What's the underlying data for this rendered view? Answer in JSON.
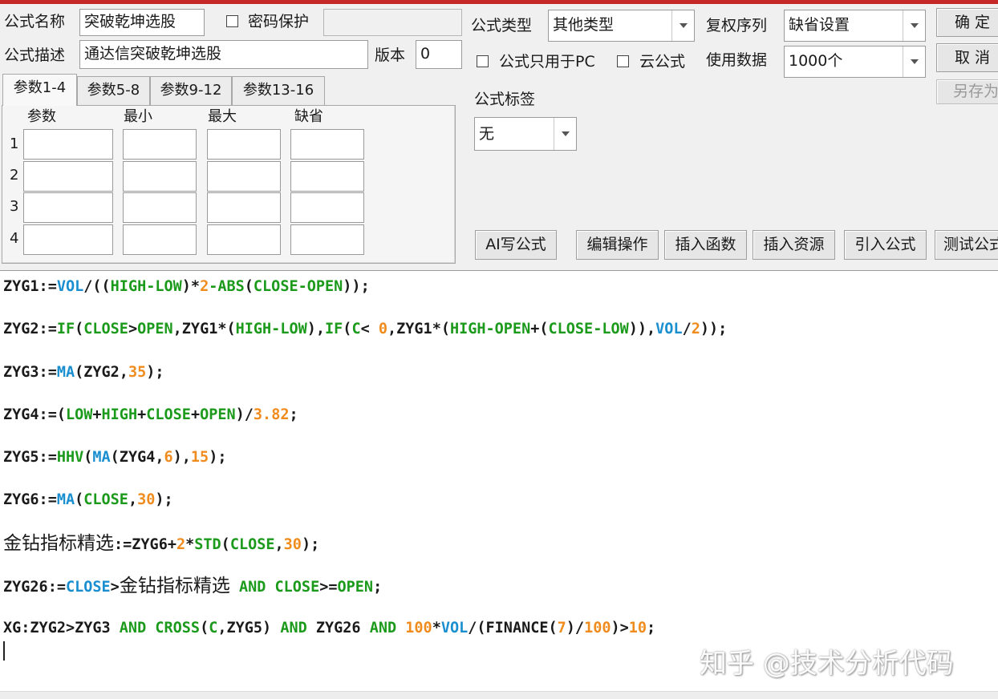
{
  "form": {
    "name_label": "公式名称",
    "name_value": "突破乾坤选股",
    "password_label": "密码保护",
    "desc_label": "公式描述",
    "desc_value": "通达信突破乾坤选股",
    "version_label": "版本",
    "version_value": "0",
    "type_label": "公式类型",
    "type_value": "其他类型",
    "fuquan_label": "复权序列",
    "fuquan_value": "缺省设置",
    "pc_only_label": "公式只用于PC",
    "cloud_label": "云公式",
    "data_label": "使用数据",
    "data_value": "1000个",
    "tag_label": "公式标签",
    "tag_value": "无"
  },
  "buttons": {
    "ok": "确 定",
    "cancel": "取 消",
    "save_as": "另存为",
    "ai_write": "AI写公式",
    "edit_ops": "编辑操作",
    "insert_func": "插入函数",
    "insert_res": "插入资源",
    "import_formula": "引入公式",
    "test_formula": "测试公式"
  },
  "params": {
    "tabs": [
      "参数1-4",
      "参数5-8",
      "参数9-12",
      "参数13-16"
    ],
    "headers": [
      "参数",
      "最小",
      "最大",
      "缺省"
    ],
    "rows": [
      "1",
      "2",
      "3",
      "4"
    ]
  },
  "code_lines": [
    [
      [
        "t",
        "ZYG1:="
      ],
      [
        "f",
        "VOL"
      ],
      [
        "t",
        "/(("
      ],
      [
        "k",
        "HIGH-LOW"
      ],
      [
        "t",
        ")*"
      ],
      [
        "n",
        "2"
      ],
      [
        "k",
        "-ABS"
      ],
      [
        "t",
        "("
      ],
      [
        "k",
        "CLOSE-OPEN"
      ],
      [
        "t",
        "));"
      ]
    ],
    [
      [
        "t",
        "ZYG2:="
      ],
      [
        "k",
        "IF"
      ],
      [
        "t",
        "("
      ],
      [
        "k",
        "CLOSE"
      ],
      [
        "t",
        ">"
      ],
      [
        "k",
        "OPEN"
      ],
      [
        "t",
        ",ZYG1*("
      ],
      [
        "k",
        "HIGH-LOW"
      ],
      [
        "t",
        "),"
      ],
      [
        "k",
        "IF"
      ],
      [
        "t",
        "("
      ],
      [
        "k",
        "C"
      ],
      [
        "t",
        "< "
      ],
      [
        "n",
        "0"
      ],
      [
        "t",
        ",ZYG1*("
      ],
      [
        "k",
        "HIGH-OPEN"
      ],
      [
        "t",
        "+("
      ],
      [
        "k",
        "CLOSE-LOW"
      ],
      [
        "t",
        ")),"
      ],
      [
        "f",
        "VOL"
      ],
      [
        "t",
        "/"
      ],
      [
        "n",
        "2"
      ],
      [
        "t",
        "));"
      ]
    ],
    [
      [
        "t",
        "ZYG3:="
      ],
      [
        "f",
        "MA"
      ],
      [
        "t",
        "(ZYG2,"
      ],
      [
        "n",
        "35"
      ],
      [
        "t",
        ");"
      ]
    ],
    [
      [
        "t",
        "ZYG4:=("
      ],
      [
        "k",
        "LOW"
      ],
      [
        "t",
        "+"
      ],
      [
        "k",
        "HIGH"
      ],
      [
        "t",
        "+"
      ],
      [
        "k",
        "CLOSE"
      ],
      [
        "t",
        "+"
      ],
      [
        "k",
        "OPEN"
      ],
      [
        "t",
        ")/"
      ],
      [
        "n",
        "3.82"
      ],
      [
        "t",
        ";"
      ]
    ],
    [
      [
        "t",
        "ZYG5:="
      ],
      [
        "k",
        "HHV"
      ],
      [
        "t",
        "("
      ],
      [
        "f",
        "MA"
      ],
      [
        "t",
        "(ZYG4,"
      ],
      [
        "n",
        "6"
      ],
      [
        "t",
        "),"
      ],
      [
        "n",
        "15"
      ],
      [
        "t",
        ");"
      ]
    ],
    [
      [
        "t",
        "ZYG6:="
      ],
      [
        "f",
        "MA"
      ],
      [
        "t",
        "("
      ],
      [
        "k",
        "CLOSE"
      ],
      [
        "t",
        ","
      ],
      [
        "n",
        "30"
      ],
      [
        "t",
        ");"
      ]
    ],
    [
      [
        "c",
        "金钻指标精选"
      ],
      [
        "t",
        ":=ZYG6+"
      ],
      [
        "n",
        "2"
      ],
      [
        "t",
        "*"
      ],
      [
        "k",
        "STD"
      ],
      [
        "t",
        "("
      ],
      [
        "k",
        "CLOSE"
      ],
      [
        "t",
        ","
      ],
      [
        "n",
        "30"
      ],
      [
        "t",
        ");"
      ]
    ],
    [
      [
        "t",
        "ZYG26:="
      ],
      [
        "f",
        "CLOSE"
      ],
      [
        "t",
        ">"
      ],
      [
        "c",
        "金钻指标精选"
      ],
      [
        "t",
        " "
      ],
      [
        "k",
        "AND"
      ],
      [
        "t",
        " "
      ],
      [
        "k",
        "CLOSE"
      ],
      [
        "t",
        ">="
      ],
      [
        "k",
        "OPEN"
      ],
      [
        "t",
        ";"
      ]
    ],
    [
      [
        "t",
        "XG:ZYG2>ZYG3 "
      ],
      [
        "k",
        "AND"
      ],
      [
        "t",
        " "
      ],
      [
        "k",
        "CROSS"
      ],
      [
        "t",
        "("
      ],
      [
        "k",
        "C"
      ],
      [
        "t",
        ",ZYG5) "
      ],
      [
        "k",
        "AND"
      ],
      [
        "t",
        " ZYG26 "
      ],
      [
        "k",
        "AND"
      ],
      [
        "t",
        " "
      ],
      [
        "n",
        "100"
      ],
      [
        "t",
        "*"
      ],
      [
        "f",
        "VOL"
      ],
      [
        "t",
        "/(FINANCE("
      ],
      [
        "n",
        "7"
      ],
      [
        "t",
        ")/"
      ],
      [
        "n",
        "100"
      ],
      [
        "t",
        ")>"
      ],
      [
        "n",
        "10"
      ],
      [
        "t",
        ";"
      ]
    ]
  ],
  "watermark": "知乎 @技术分析代码"
}
